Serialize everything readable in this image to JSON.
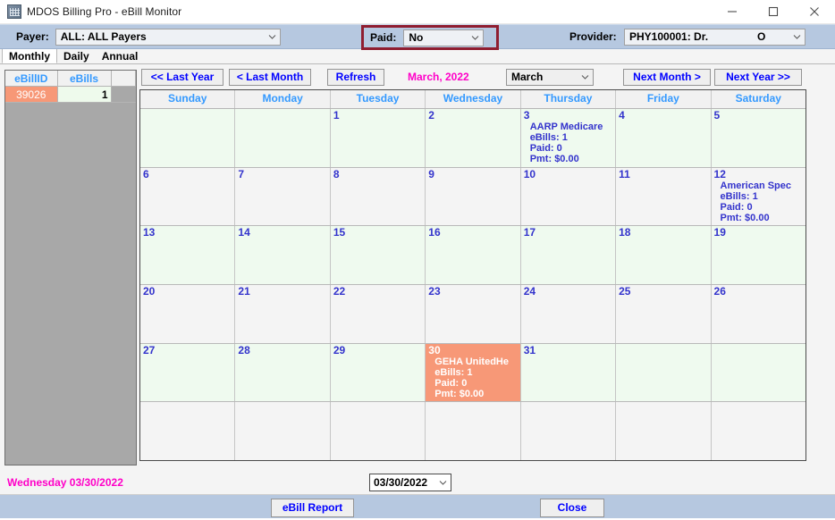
{
  "window": {
    "title": "MDOS Billing Pro - eBill Monitor",
    "icon": "app-icon",
    "minimize": "—",
    "maximize": "□",
    "close": "✕"
  },
  "toolbar": {
    "payer_label": "Payer:",
    "payer_value": "ALL: ALL Payers",
    "paid_label": "Paid:",
    "paid_value": "No",
    "provider_label": "Provider:",
    "provider_value": "PHY100001: Dr. ",
    "provider_value_tail": "O",
    "highlight_color": "#8f1d30"
  },
  "tabs": [
    {
      "label": "Monthly",
      "active": true
    },
    {
      "label": "Daily",
      "active": false
    },
    {
      "label": "Annual",
      "active": false
    }
  ],
  "grid": {
    "columns": [
      "eBillID",
      "eBills"
    ],
    "rows": [
      {
        "ebill_id": "39026",
        "ebills": "1",
        "selected": true
      }
    ]
  },
  "nav": {
    "last_year": "<<  Last Year",
    "last_month": "<  Last Month",
    "refresh": "Refresh",
    "period_label": "March, 2022",
    "month_select": "March",
    "next_month": "Next Month  >",
    "next_year": "Next Year  >>"
  },
  "calendar": {
    "daynames": [
      "Sunday",
      "Monday",
      "Tuesday",
      "Wednesday",
      "Thursday",
      "Friday",
      "Saturday"
    ],
    "weeks": [
      {
        "shade": "green",
        "days": [
          {
            "num": ""
          },
          {
            "num": ""
          },
          {
            "num": "1"
          },
          {
            "num": "2"
          },
          {
            "num": "3",
            "lines": [
              "AARP Medicare",
              "eBills: 1",
              "Paid: 0",
              "Pmt: $0.00"
            ]
          },
          {
            "num": "4"
          },
          {
            "num": "5"
          }
        ]
      },
      {
        "shade": "plain",
        "days": [
          {
            "num": "6"
          },
          {
            "num": "7"
          },
          {
            "num": "8"
          },
          {
            "num": "9"
          },
          {
            "num": "10"
          },
          {
            "num": "11"
          },
          {
            "num": "12",
            "lines": [
              "American Spec",
              "eBills: 1",
              "Paid: 0",
              "Pmt: $0.00"
            ]
          }
        ]
      },
      {
        "shade": "green",
        "days": [
          {
            "num": "13"
          },
          {
            "num": "14"
          },
          {
            "num": "15"
          },
          {
            "num": "16"
          },
          {
            "num": "17"
          },
          {
            "num": "18"
          },
          {
            "num": "19"
          }
        ]
      },
      {
        "shade": "plain",
        "days": [
          {
            "num": "20"
          },
          {
            "num": "21"
          },
          {
            "num": "22"
          },
          {
            "num": "23"
          },
          {
            "num": "24"
          },
          {
            "num": "25"
          },
          {
            "num": "26"
          }
        ]
      },
      {
        "shade": "green",
        "days": [
          {
            "num": "27"
          },
          {
            "num": "28"
          },
          {
            "num": "29"
          },
          {
            "num": "30",
            "selected": true,
            "lines": [
              "GEHA UnitedHe",
              "eBills: 1",
              "Paid: 0",
              "Pmt: $0.00"
            ]
          },
          {
            "num": "31"
          },
          {
            "num": ""
          },
          {
            "num": ""
          }
        ]
      },
      {
        "shade": "plain",
        "days": [
          {
            "num": ""
          },
          {
            "num": ""
          },
          {
            "num": ""
          },
          {
            "num": ""
          },
          {
            "num": ""
          },
          {
            "num": ""
          },
          {
            "num": ""
          }
        ]
      }
    ]
  },
  "status": {
    "selected_date_text": "Wednesday 03/30/2022",
    "date_picker_value": "03/30/2022"
  },
  "footer": {
    "ebill_report": "eBill Report",
    "close": "Close"
  }
}
